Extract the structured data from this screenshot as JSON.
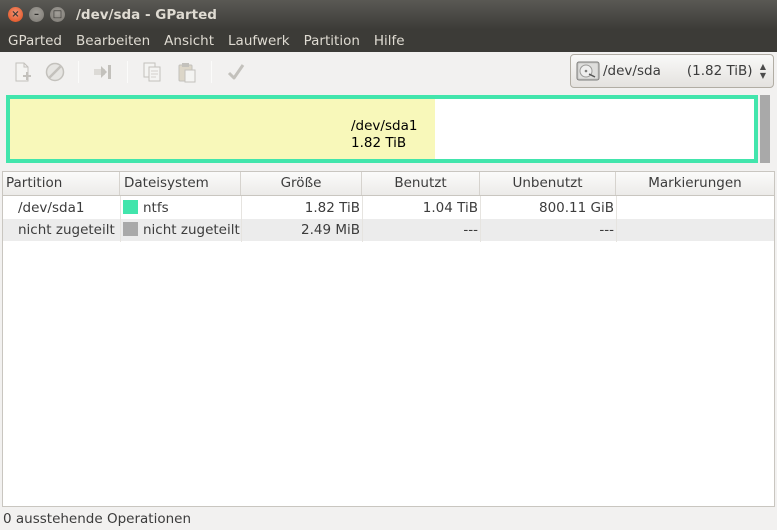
{
  "window": {
    "title": "/dev/sda - GParted",
    "buttons": {
      "close": "×",
      "minimize": "–",
      "maximize": "□"
    }
  },
  "menubar": {
    "items": [
      "GParted",
      "Bearbeiten",
      "Ansicht",
      "Laufwerk",
      "Partition",
      "Hilfe"
    ]
  },
  "toolbar": {
    "icons": [
      "new-partition-icon",
      "delete-icon",
      "resize-move-icon",
      "copy-icon",
      "paste-icon",
      "apply-icon"
    ]
  },
  "device_selector": {
    "device": "/dev/sda",
    "size": "(1.82 TiB)",
    "icon": "harddisk-icon"
  },
  "diskmap": {
    "partition_name": "/dev/sda1",
    "partition_size": "1.82 TiB",
    "colors": {
      "border": "#42e5ac",
      "used": "#f8f8ba",
      "unallocated": "#a9a9a9"
    }
  },
  "table": {
    "headers": [
      "Partition",
      "Dateisystem",
      "Größe",
      "Benutzt",
      "Unbenutzt",
      "Markierungen"
    ],
    "rows": [
      {
        "partition": "/dev/sda1",
        "filesystem": "ntfs",
        "fs_color": "#42e5ac",
        "size": "1.82 TiB",
        "used": "1.04 TiB",
        "unused": "800.11 GiB",
        "flags": ""
      },
      {
        "partition": "nicht zugeteilt",
        "filesystem": "nicht zugeteilt",
        "fs_color": "#a9a9a9",
        "size": "2.49 MiB",
        "used": "---",
        "unused": "---",
        "flags": ""
      }
    ]
  },
  "statusbar": {
    "text": "0 ausstehende Operationen"
  }
}
